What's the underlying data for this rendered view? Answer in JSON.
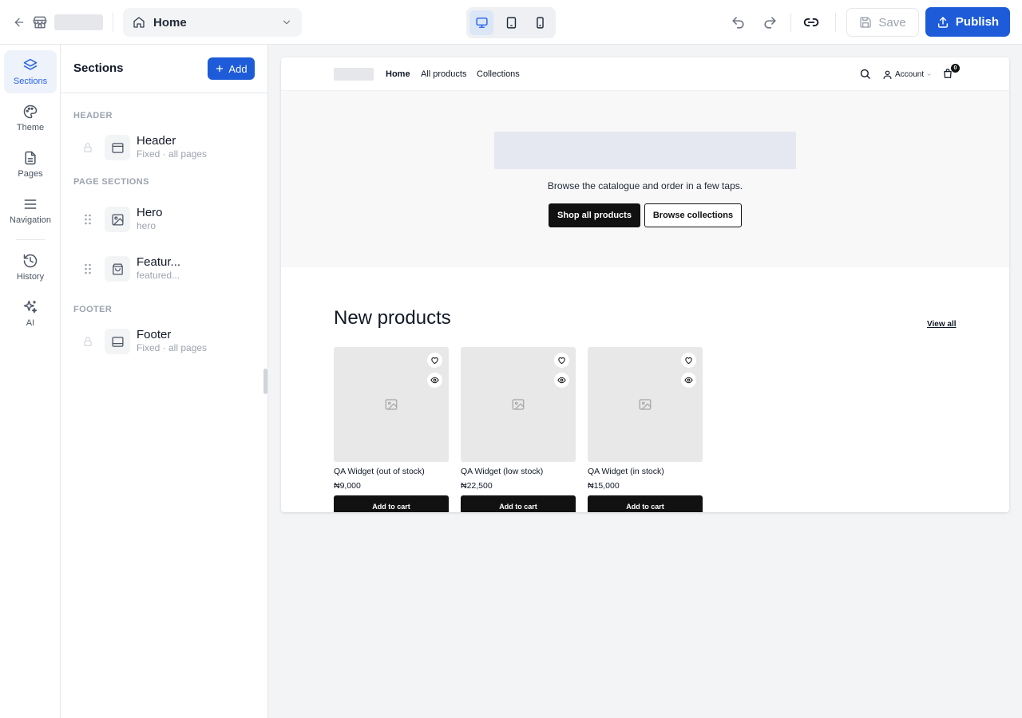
{
  "topbar": {
    "page_select": "Home",
    "save_label": "Save",
    "publish_label": "Publish",
    "accent": "#1d5bd8"
  },
  "rail": {
    "items": [
      {
        "label": "Sections",
        "icon": "layers-icon"
      },
      {
        "label": "Theme",
        "icon": "palette-icon"
      },
      {
        "label": "Pages",
        "icon": "page-icon"
      },
      {
        "label": "Navigation",
        "icon": "menu-icon"
      },
      {
        "label": "History",
        "icon": "history-icon"
      },
      {
        "label": "AI",
        "icon": "sparkles-icon"
      }
    ]
  },
  "panel": {
    "title": "Sections",
    "add_label": "Add",
    "groups": {
      "header": "HEADER",
      "page_sections": "PAGE SECTIONS",
      "footer": "FOOTER"
    },
    "sections": [
      {
        "name": "Header",
        "sub": "Fixed · all pages"
      },
      {
        "name": "Hero",
        "sub": "hero"
      },
      {
        "name": "Featur...",
        "sub": "featured..."
      },
      {
        "name": "Footer",
        "sub": "Fixed · all pages"
      }
    ]
  },
  "preview": {
    "nav": [
      "Home",
      "All products",
      "Collections"
    ],
    "account_label": "Account",
    "cart_count": "0",
    "hero": {
      "subtitle": "Browse the catalogue and order in a few taps.",
      "primary_cta": "Shop all products",
      "secondary_cta": "Browse collections"
    },
    "new_products": {
      "title": "New products",
      "view_all": "View all",
      "cart_label": "Add to cart",
      "items": [
        {
          "name": "QA Widget (out of stock)",
          "price": "₦9,000"
        },
        {
          "name": "QA Widget (low stock)",
          "price": "₦22,500"
        },
        {
          "name": "QA Widget (in stock)",
          "price": "₦15,000"
        }
      ]
    }
  }
}
